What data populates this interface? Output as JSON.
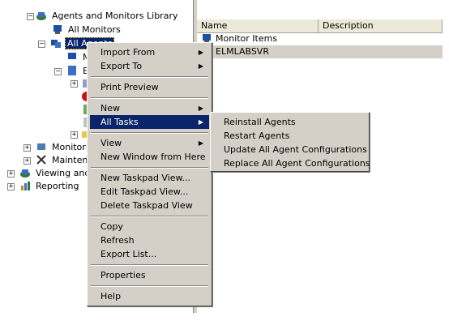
{
  "tree": {
    "items": [
      {
        "label": "Agents and Monitors Library",
        "icon": "library-icon"
      },
      {
        "label": "All Monitors",
        "icon": "monitor-icon"
      },
      {
        "label": "All Agents",
        "icon": "agents-icon"
      },
      {
        "label": "M",
        "icon": "monitor-icon"
      },
      {
        "label": "E",
        "icon": "server-icon"
      },
      {
        "label": "Monitorin",
        "icon": "monitoring-icon"
      },
      {
        "label": "Maintena",
        "icon": "maintenance-icon"
      },
      {
        "label": "Viewing and I",
        "icon": "viewing-icon"
      },
      {
        "label": "Reporting",
        "icon": "reporting-icon"
      }
    ]
  },
  "listview": {
    "columns": [
      "Name",
      "Description"
    ],
    "rows": [
      {
        "name": "Monitor Items",
        "icon": "monitor-icon"
      },
      {
        "name": "ELMLABSVR",
        "icon": "server-icon"
      }
    ]
  },
  "context_menu": {
    "items": [
      {
        "label": "Import From",
        "submenu": true
      },
      {
        "label": "Export To",
        "submenu": true
      },
      {
        "label": "Print Preview"
      },
      {
        "label": "New",
        "submenu": true
      },
      {
        "label": "All Tasks",
        "submenu": true,
        "highlighted": true
      },
      {
        "label": "View",
        "submenu": true
      },
      {
        "label": "New Window from Here"
      },
      {
        "label": "New Taskpad View..."
      },
      {
        "label": "Edit Taskpad View..."
      },
      {
        "label": "Delete Taskpad View"
      },
      {
        "label": "Copy"
      },
      {
        "label": "Refresh"
      },
      {
        "label": "Export List..."
      },
      {
        "label": "Properties"
      },
      {
        "label": "Help"
      }
    ]
  },
  "submenu": {
    "items": [
      {
        "label": "Reinstall Agents"
      },
      {
        "label": "Restart Agents"
      },
      {
        "label": "Update All Agent Configurations"
      },
      {
        "label": "Replace All Agent Configurations"
      }
    ]
  }
}
